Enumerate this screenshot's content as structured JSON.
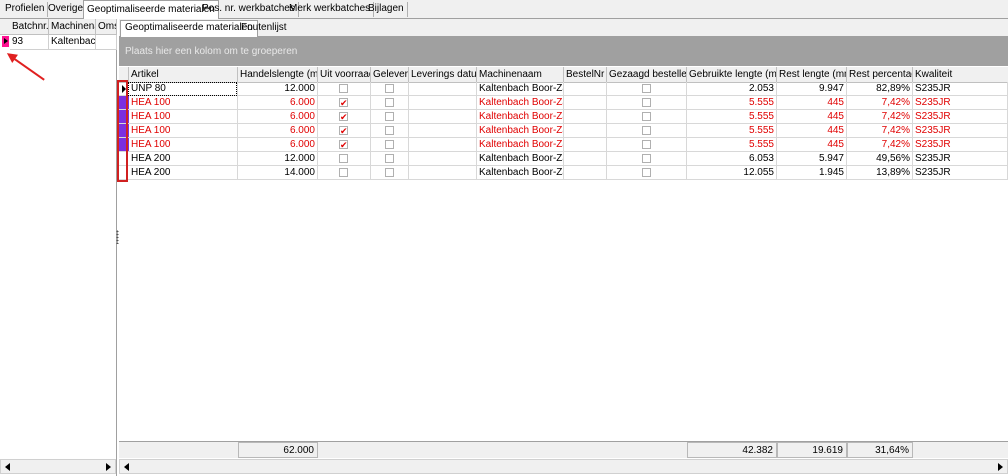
{
  "top_tabs": [
    "Profielen",
    "Overige",
    "Geoptimaliseerde materialen",
    "Pos. nr. werkbatches",
    "Merk werkbatches",
    "Bijlagen"
  ],
  "left_grid": {
    "headers": [
      "Batchnr.",
      "Machinena",
      "Oms"
    ],
    "row": [
      "93",
      "Kaltenbach",
      ""
    ]
  },
  "inner_tabs": [
    "Geoptimaliseerde materialen",
    "Foutenlijst"
  ],
  "group_panel_text": "Plaats hier een kolom om te groeperen",
  "columns": [
    "Artikel",
    "Handelslengte (mm)",
    "Uit voorraad",
    "Geleverd",
    "Leverings datum",
    "Machinenaam",
    "BestelNr",
    "Gezaagd bestellen",
    "Gebruikte lengte (mm)",
    "Rest lengte (mm)",
    "Rest percentage",
    "Kwaliteit"
  ],
  "rows": [
    {
      "artikel": "UNP  80",
      "handelslengte": "12.000",
      "uit_voorraad": "",
      "geleverd": "",
      "leverings_datum": "",
      "machinenaam": "Kaltenbach Boor-Zaag",
      "bestelnr": "",
      "gezaagd": "",
      "gebruikte": "2.053",
      "rest": "9.947",
      "rest_pct": "82,89%",
      "kwaliteit": "S235JR",
      "color": "#000000",
      "indicator": "arrow"
    },
    {
      "artikel": "HEA  100",
      "handelslengte": "6.000",
      "uit_voorraad": "✔",
      "geleverd": "",
      "leverings_datum": "",
      "machinenaam": "Kaltenbach Boor-Zaag",
      "bestelnr": "",
      "gezaagd": "",
      "gebruikte": "5.555",
      "rest": "445",
      "rest_pct": "7,42%",
      "kwaliteit": "S235JR",
      "color": "#e00000",
      "indicator": "purple"
    },
    {
      "artikel": "HEA  100",
      "handelslengte": "6.000",
      "uit_voorraad": "✔",
      "geleverd": "",
      "leverings_datum": "",
      "machinenaam": "Kaltenbach Boor-Zaag",
      "bestelnr": "",
      "gezaagd": "",
      "gebruikte": "5.555",
      "rest": "445",
      "rest_pct": "7,42%",
      "kwaliteit": "S235JR",
      "color": "#e00000",
      "indicator": "purple"
    },
    {
      "artikel": "HEA  100",
      "handelslengte": "6.000",
      "uit_voorraad": "✔",
      "geleverd": "",
      "leverings_datum": "",
      "machinenaam": "Kaltenbach Boor-Zaag",
      "bestelnr": "",
      "gezaagd": "",
      "gebruikte": "5.555",
      "rest": "445",
      "rest_pct": "7,42%",
      "kwaliteit": "S235JR",
      "color": "#e00000",
      "indicator": "purple"
    },
    {
      "artikel": "HEA  100",
      "handelslengte": "6.000",
      "uit_voorraad": "✔",
      "geleverd": "",
      "leverings_datum": "",
      "machinenaam": "Kaltenbach Boor-Zaag",
      "bestelnr": "",
      "gezaagd": "",
      "gebruikte": "5.555",
      "rest": "445",
      "rest_pct": "7,42%",
      "kwaliteit": "S235JR",
      "color": "#e00000",
      "indicator": "purple"
    },
    {
      "artikel": "HEA  200",
      "handelslengte": "12.000",
      "uit_voorraad": "",
      "geleverd": "",
      "leverings_datum": "",
      "machinenaam": "Kaltenbach Boor-Zaag",
      "bestelnr": "",
      "gezaagd": "",
      "gebruikte": "6.053",
      "rest": "5.947",
      "rest_pct": "49,56%",
      "kwaliteit": "S235JR",
      "color": "#000000",
      "indicator": "none"
    },
    {
      "artikel": "HEA  200",
      "handelslengte": "14.000",
      "uit_voorraad": "",
      "geleverd": "",
      "leverings_datum": "",
      "machinenaam": "Kaltenbach Boor-Zaag",
      "bestelnr": "",
      "gezaagd": "",
      "gebruikte": "12.055",
      "rest": "1.945",
      "rest_pct": "13,89%",
      "kwaliteit": "S235JR",
      "color": "#000000",
      "indicator": "none"
    }
  ],
  "totals": {
    "handelslengte": "62.000",
    "gebruikte": "42.382",
    "rest": "19.619",
    "rest_pct": "31,64%"
  },
  "colors": {
    "accent_pink": "#ff1493",
    "row_indicator": "#7b2fe0",
    "error_text": "#e00000",
    "annotation": "#d02020"
  }
}
